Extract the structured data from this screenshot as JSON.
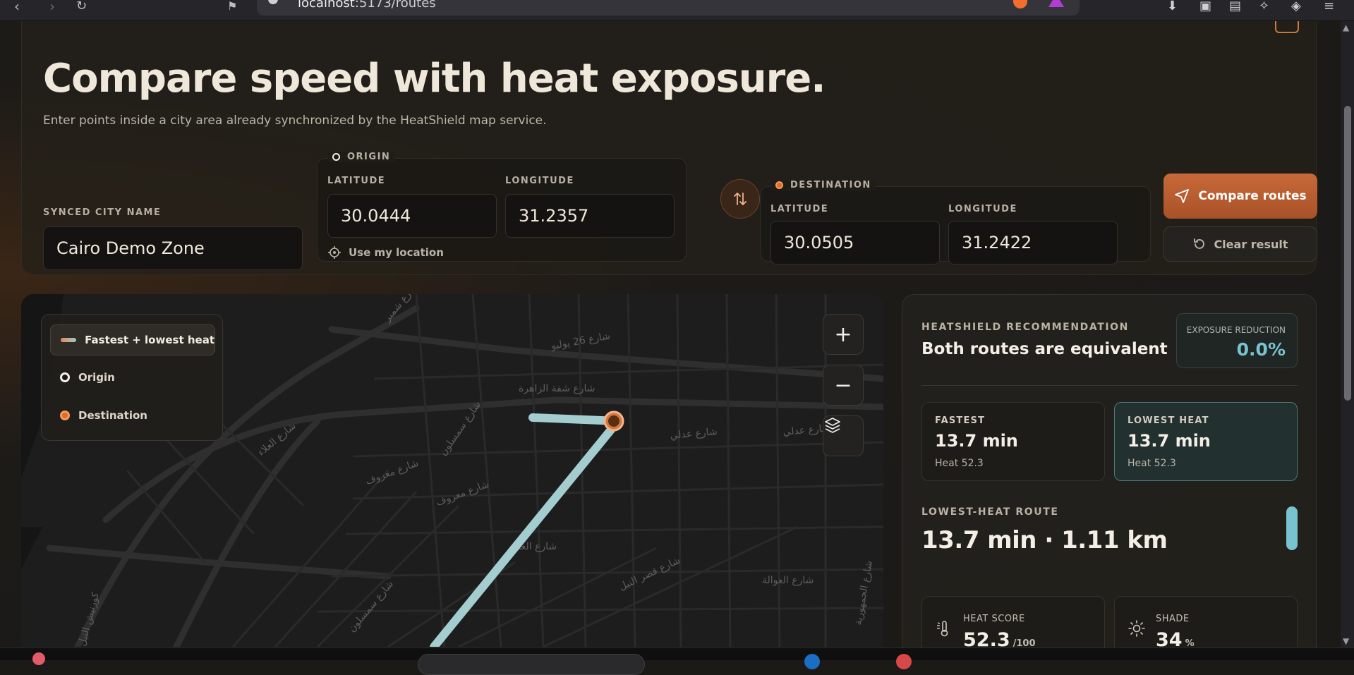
{
  "browser": {
    "url_host": "localhost",
    "url_path": ":5173/routes"
  },
  "hero": {
    "title": "Compare speed with heat exposure.",
    "subtitle": "Enter points inside a city area already synchronized by the HeatShield map service.",
    "city_label": "SYNCED CITY NAME",
    "city_value": "Cairo Demo Zone",
    "origin": {
      "title": "ORIGIN",
      "lat_label": "LATITUDE",
      "lat_value": "30.0444",
      "lon_label": "LONGITUDE",
      "lon_value": "31.2357",
      "use_location": "Use my location"
    },
    "destination": {
      "title": "DESTINATION",
      "lat_label": "LATITUDE",
      "lat_value": "30.0505",
      "lon_label": "LONGITUDE",
      "lon_value": "31.2422"
    },
    "compare_button": "Compare routes",
    "clear_button": "Clear result"
  },
  "map": {
    "legend": {
      "route": "Fastest + lowest heat",
      "origin": "Origin",
      "destination": "Destination"
    },
    "streets": [
      {
        "text": "شارع 26 يوليو"
      },
      {
        "text": "شارع شفة الزاهرة"
      },
      {
        "text": "شارع سمسلون"
      },
      {
        "text": "شارع عدلي"
      },
      {
        "text": "شارع عدلي"
      },
      {
        "text": "شارع معروف"
      },
      {
        "text": "شارع معروف"
      },
      {
        "text": "شارع العمل"
      },
      {
        "text": "شارع قصر النيل"
      },
      {
        "text": "شارع العوالة"
      },
      {
        "text": "شارع الجمهورية"
      },
      {
        "text": "شارع العلاء"
      },
      {
        "text": "كورنيش النيل"
      },
      {
        "text": "شارع سمسلون"
      },
      {
        "text": "شارع شمبر"
      }
    ],
    "route_color": "#a4cdd0",
    "dest_marker_color": "#d27840"
  },
  "panel": {
    "kicker": "HEATSHIELD RECOMMENDATION",
    "title": "Both routes are equivalent",
    "reduction_label": "EXPOSURE REDUCTION",
    "reduction_value": "0.0%",
    "fastest": {
      "label": "FASTEST",
      "value": "13.7 min",
      "sub": "Heat 52.3"
    },
    "lowest": {
      "label": "LOWEST HEAT",
      "value": "13.7 min",
      "sub": "Heat 52.3"
    },
    "route_label": "LOWEST-HEAT ROUTE",
    "route_value": "13.7 min · 1.11 km",
    "heat_score_label": "HEAT SCORE",
    "heat_score_value": "52.3",
    "heat_score_unit": "/100",
    "shade_label": "SHADE",
    "shade_value": "34",
    "shade_unit": "%"
  },
  "colors": {
    "accent": "#c7693a",
    "teal": "#79c2cf",
    "background": "#1b1a17"
  }
}
